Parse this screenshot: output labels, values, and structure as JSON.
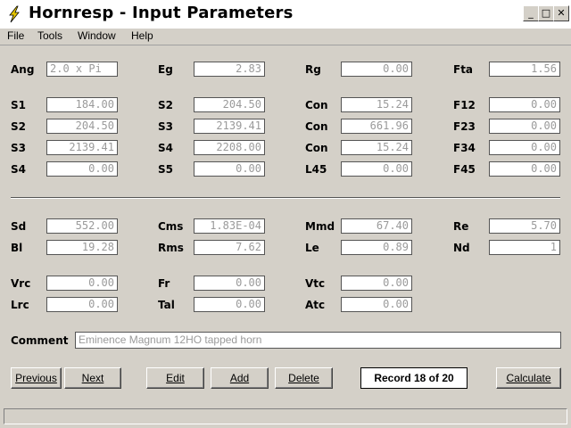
{
  "window": {
    "title": "Hornresp - Input Parameters",
    "controls": {
      "minimize": "_",
      "maximize": "□",
      "close": "✕"
    }
  },
  "menu": [
    "File",
    "Tools",
    "Window",
    "Help"
  ],
  "params": {
    "row1": [
      {
        "label": "Ang",
        "value": "2.0 x Pi"
      },
      {
        "label": "Eg",
        "value": "2.83"
      },
      {
        "label": "Rg",
        "value": "0.00"
      },
      {
        "label": "Fta",
        "value": "1.56"
      }
    ],
    "row2": [
      {
        "label": "S1",
        "value": "184.00"
      },
      {
        "label": "S2",
        "value": "204.50"
      },
      {
        "label": "Con",
        "value": "15.24"
      },
      {
        "label": "F12",
        "value": "0.00"
      }
    ],
    "row3": [
      {
        "label": "S2",
        "value": "204.50"
      },
      {
        "label": "S3",
        "value": "2139.41"
      },
      {
        "label": "Con",
        "value": "661.96"
      },
      {
        "label": "F23",
        "value": "0.00"
      }
    ],
    "row4": [
      {
        "label": "S3",
        "value": "2139.41"
      },
      {
        "label": "S4",
        "value": "2208.00"
      },
      {
        "label": "Con",
        "value": "15.24"
      },
      {
        "label": "F34",
        "value": "0.00"
      }
    ],
    "row5": [
      {
        "label": "S4",
        "value": "0.00"
      },
      {
        "label": "S5",
        "value": "0.00"
      },
      {
        "label": "L45",
        "value": "0.00"
      },
      {
        "label": "F45",
        "value": "0.00"
      }
    ],
    "row6": [
      {
        "label": "Sd",
        "value": "552.00"
      },
      {
        "label": "Cms",
        "value": "1.83E-04"
      },
      {
        "label": "Mmd",
        "value": "67.40"
      },
      {
        "label": "Re",
        "value": "5.70"
      }
    ],
    "row7": [
      {
        "label": "Bl",
        "value": "19.28"
      },
      {
        "label": "Rms",
        "value": "7.62"
      },
      {
        "label": "Le",
        "value": "0.89"
      },
      {
        "label": "Nd",
        "value": "1"
      }
    ],
    "row8": [
      {
        "label": "Vrc",
        "value": "0.00"
      },
      {
        "label": "Fr",
        "value": "0.00"
      },
      {
        "label": "Vtc",
        "value": "0.00"
      }
    ],
    "row9": [
      {
        "label": "Lrc",
        "value": "0.00"
      },
      {
        "label": "Tal",
        "value": "0.00"
      },
      {
        "label": "Atc",
        "value": "0.00"
      }
    ]
  },
  "comment": {
    "label": "Comment",
    "value": "Eminence Magnum 12HO tapped horn"
  },
  "buttons": {
    "previous": "Previous",
    "next": "Next",
    "edit": "Edit",
    "add": "Add",
    "delete": "Delete",
    "calculate": "Calculate"
  },
  "record": "Record 18 of 20",
  "colors": {
    "background": "#d4d0c8",
    "field_text": "#9a9a9a",
    "icon_yellow": "#e8c800"
  }
}
